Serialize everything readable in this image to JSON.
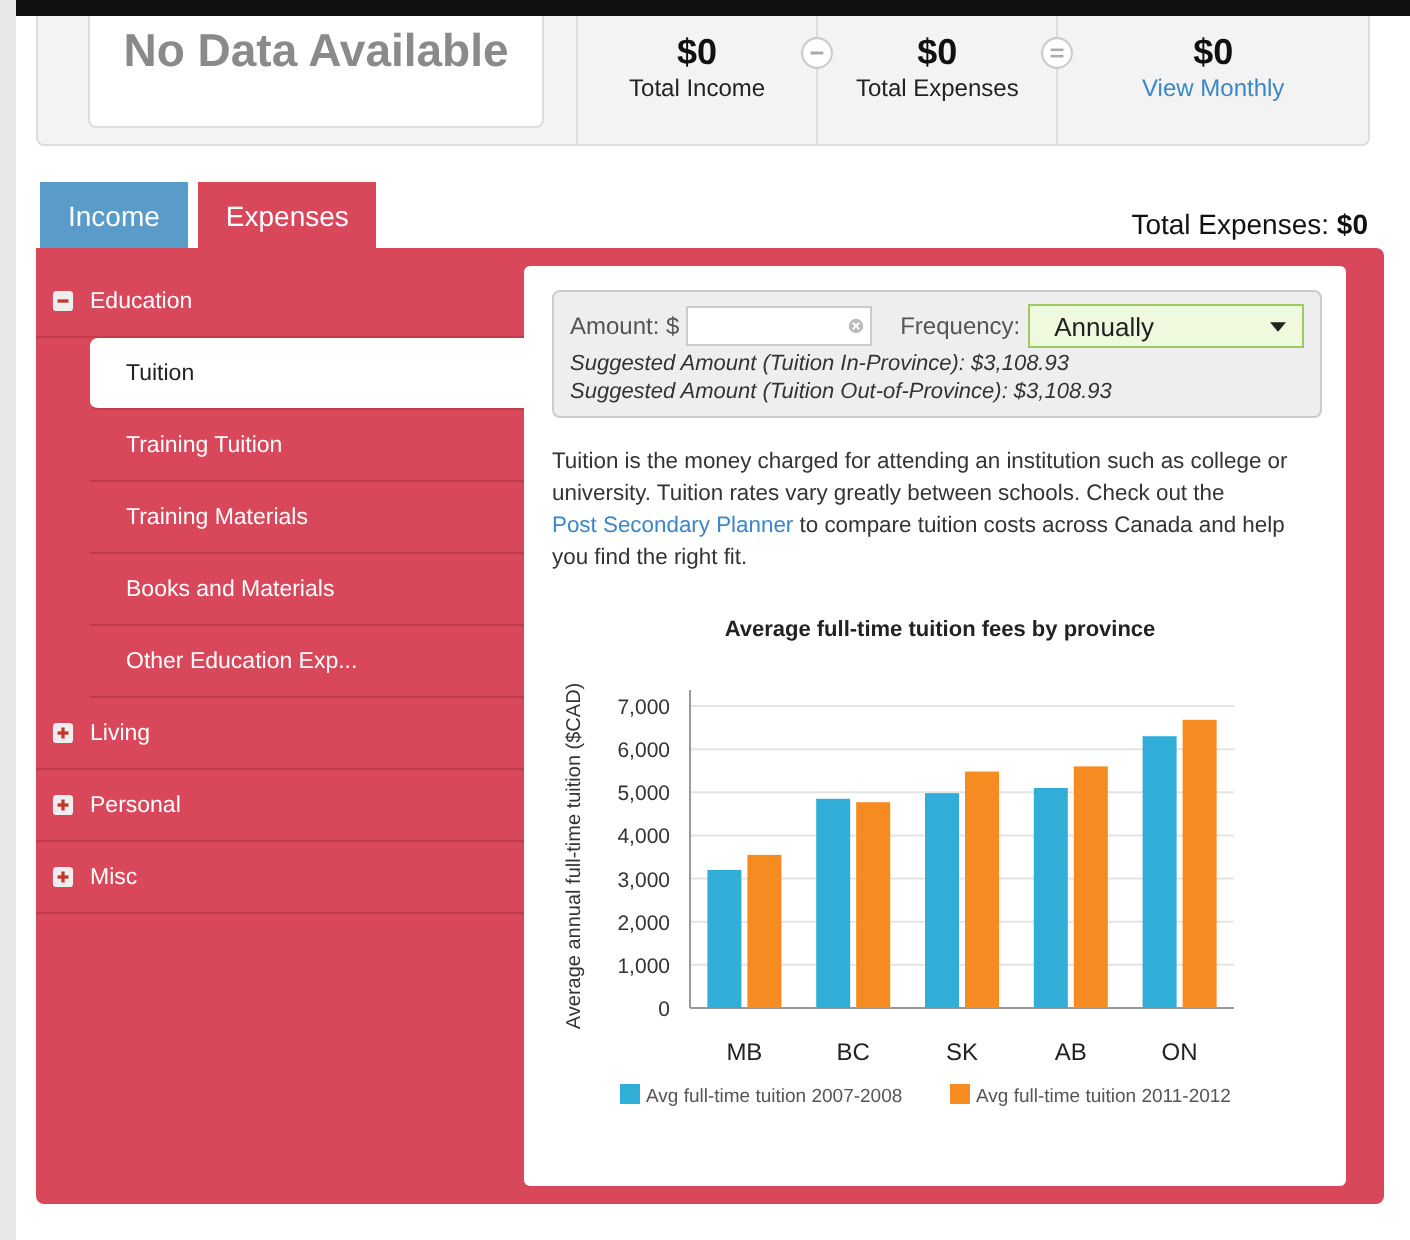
{
  "summary": {
    "no_data": "No Data Available",
    "totals": [
      {
        "amount": "$0",
        "label": "Total Income",
        "kind": "text"
      },
      {
        "amount": "$0",
        "label": "Total Expenses",
        "kind": "text"
      },
      {
        "amount": "$0",
        "label": "View Monthly",
        "kind": "link"
      }
    ]
  },
  "tabs": [
    {
      "label": "Income",
      "selected": false
    },
    {
      "label": "Expenses",
      "selected": true
    }
  ],
  "total_expenses": "Total Expenses: **$0**",
  "sidebar": {
    "items": [
      {
        "label": "Education",
        "expanded": true,
        "children": [
          {
            "label": "Tuition",
            "selected": true
          },
          {
            "label": "Training Tuition",
            "selected": false
          },
          {
            "label": "Training Materials",
            "selected": false
          },
          {
            "label": "Books and Materials",
            "selected": false
          },
          {
            "label": "Other Education Exp...",
            "selected": false
          }
        ]
      },
      {
        "label": "Living",
        "expanded": false
      },
      {
        "label": "Personal",
        "expanded": false
      },
      {
        "label": "Misc",
        "expanded": false
      }
    ]
  },
  "form": {
    "amount_label": "Amount: $",
    "frequency_label": "Frequency:",
    "frequency": "Annually",
    "suggestions": [
      "Suggested Amount (Tuition In-Province): $3,108.93",
      "Suggested Amount (Tuition Out-of-Province): $3,108.93"
    ]
  },
  "description": {
    "before": "Tuition is the money charged for attending an institution such as college or university. Tuition rates vary greatly between schools. Check out the ",
    "link": "Post Secondary Planner",
    "after": " to compare tuition costs across Canada and help you find the right fit."
  },
  "chart_data": {
    "type": "bar",
    "title": "Average full-time tuition fees by province",
    "ylabel": "Average annual full-time tuition ($CAD)",
    "categories": [
      "MB",
      "BC",
      "SK",
      "AB",
      "ON"
    ],
    "series": [
      {
        "name": "Avg full-time tuition 2007-2008",
        "color": "#31aed8",
        "values": [
          3200,
          4850,
          4980,
          5100,
          6300
        ]
      },
      {
        "name": "Avg full-time tuition 2011-2012",
        "color": "#f68b22",
        "values": [
          3550,
          4770,
          5480,
          5600,
          6680
        ]
      }
    ],
    "ylim": [
      0,
      7000
    ],
    "grid": true,
    "legend": true,
    "yticks": [
      {
        "value": 0,
        "label": "0"
      },
      {
        "value": 1000,
        "label": "1,000"
      },
      {
        "value": 2000,
        "label": "2,000"
      },
      {
        "value": 3000,
        "label": "3,000"
      },
      {
        "value": 4000,
        "label": "4,000"
      },
      {
        "value": 5000,
        "label": "5,000"
      },
      {
        "value": 6000,
        "label": "6,000"
      },
      {
        "value": 7000,
        "label": "7,000"
      }
    ]
  }
}
